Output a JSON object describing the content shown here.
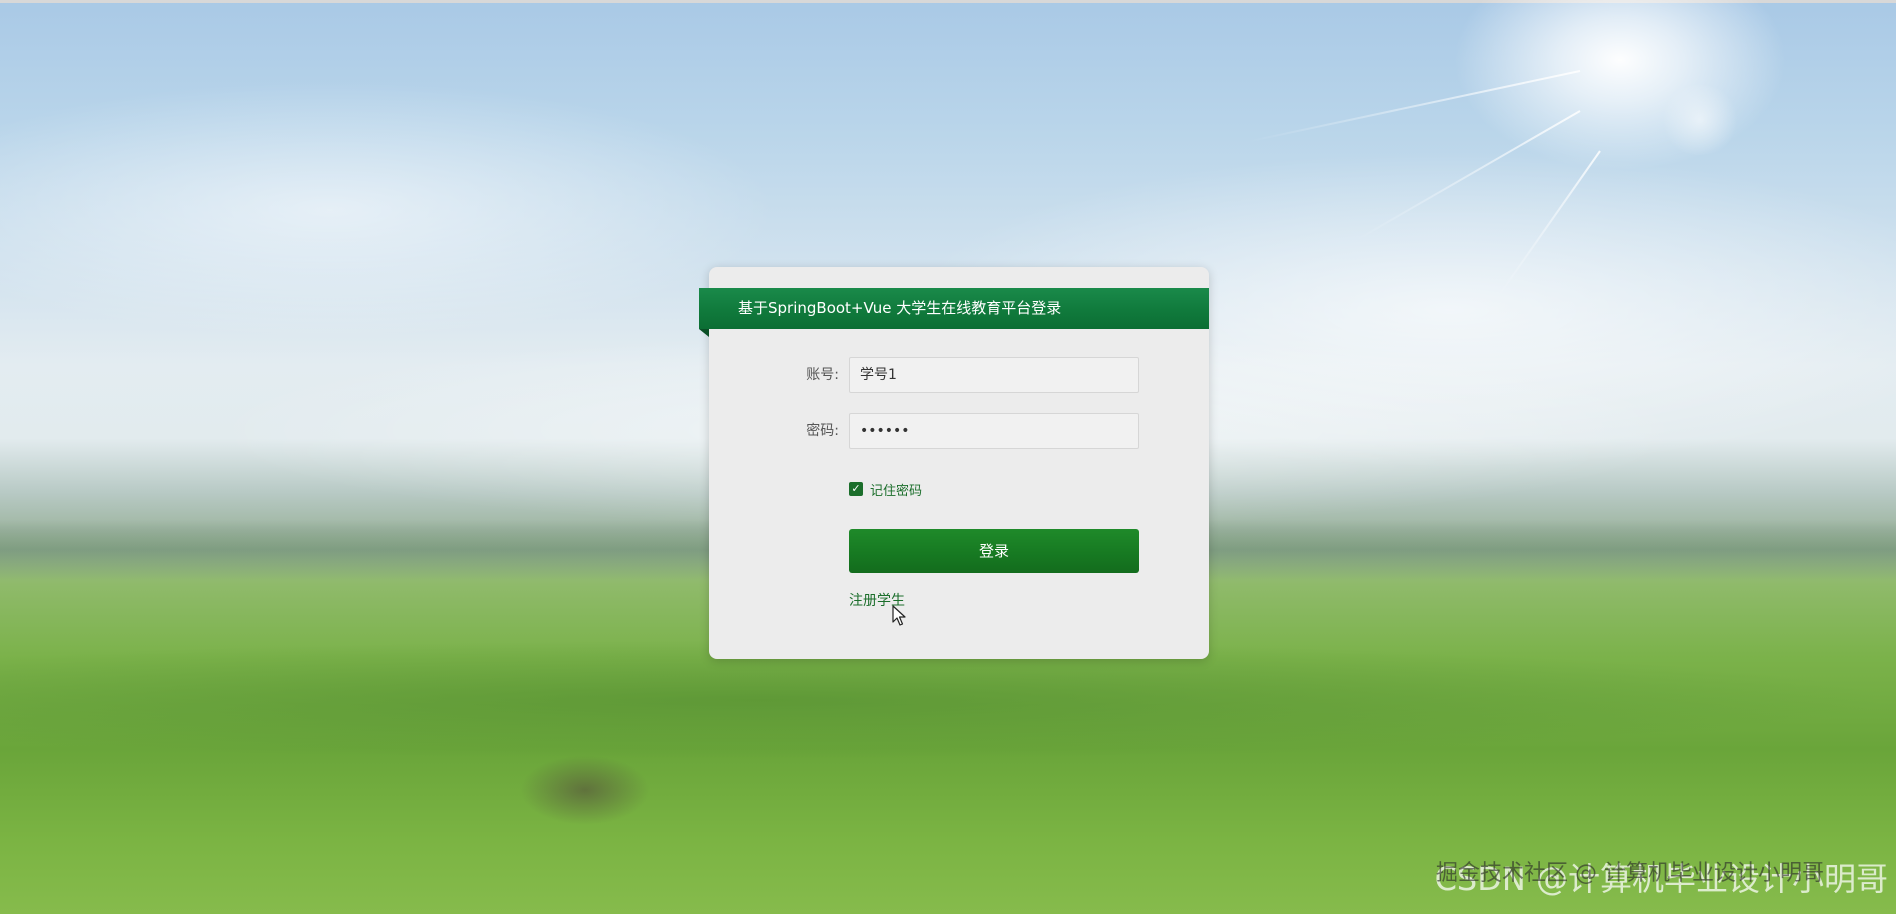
{
  "login": {
    "title": "基于SpringBoot+Vue 大学生在线教育平台登录",
    "account_label": "账号:",
    "account_value": "学号1",
    "password_label": "密码:",
    "password_value": "••••••",
    "remember_label": "记住密码",
    "remember_checked": true,
    "login_button": "登录",
    "register_link": "注册学生"
  },
  "watermark": {
    "csdn": "CSDN @计算机毕业设计小明哥",
    "juejin": "掘金技术社区 @ 计算机毕业设计小明哥"
  },
  "colors": {
    "accent_green": "#107a3c",
    "button_green": "#177a22",
    "link_green": "#1b6e2b"
  },
  "icons": {
    "checkbox": "checkmark-icon",
    "cursor": "mouse-pointer-icon"
  }
}
